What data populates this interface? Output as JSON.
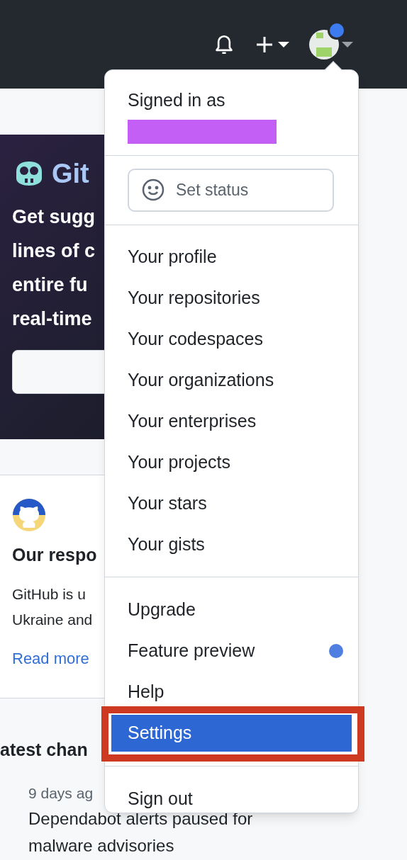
{
  "header": {
    "avatar_unread": true
  },
  "banner": {
    "title": "Git",
    "lines": [
      "Get sugg",
      "lines of c",
      "entire fu",
      "real-time"
    ]
  },
  "news_card": {
    "title": "Our respo",
    "lines": [
      "GitHub is u",
      "Ukraine and"
    ],
    "link": "Read more"
  },
  "changelog": {
    "heading": "atest chan",
    "date": "9 days ag",
    "lines": [
      "Dependabot alerts paused for",
      "malware advisories"
    ]
  },
  "menu": {
    "signed_in_label": "Signed in as",
    "status_button": "Set status",
    "sections": [
      [
        {
          "label": "Your profile",
          "selected": false,
          "dot": false
        },
        {
          "label": "Your repositories",
          "selected": false,
          "dot": false
        },
        {
          "label": "Your codespaces",
          "selected": false,
          "dot": false
        },
        {
          "label": "Your organizations",
          "selected": false,
          "dot": false
        },
        {
          "label": "Your enterprises",
          "selected": false,
          "dot": false
        },
        {
          "label": "Your projects",
          "selected": false,
          "dot": false
        },
        {
          "label": "Your stars",
          "selected": false,
          "dot": false
        },
        {
          "label": "Your gists",
          "selected": false,
          "dot": false
        }
      ],
      [
        {
          "label": "Upgrade",
          "selected": false,
          "dot": false
        },
        {
          "label": "Feature preview",
          "selected": false,
          "dot": true
        },
        {
          "label": "Help",
          "selected": false,
          "dot": false
        },
        {
          "label": "Settings",
          "selected": true,
          "dot": false
        }
      ],
      [
        {
          "label": "Sign out",
          "selected": false,
          "dot": false
        }
      ]
    ]
  }
}
